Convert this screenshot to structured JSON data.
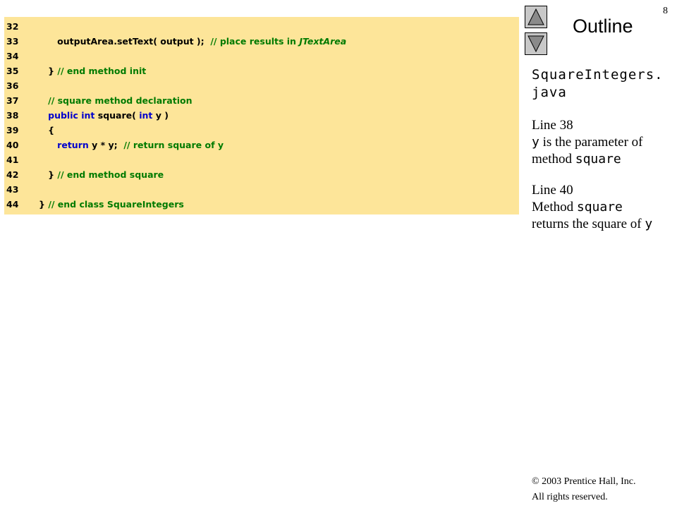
{
  "slide": {
    "number": "8",
    "outline_label": "Outline"
  },
  "code": {
    "lines": [
      {
        "num": "32",
        "segments": []
      },
      {
        "num": "33",
        "segments": [
          {
            "text": "         outputArea.setText( output );  ",
            "style": "plain"
          },
          {
            "text": "// place results in ",
            "style": "comment"
          },
          {
            "text": "JTextArea",
            "style": "comment-italic"
          }
        ]
      },
      {
        "num": "34",
        "segments": []
      },
      {
        "num": "35",
        "segments": [
          {
            "text": "      } ",
            "style": "plain"
          },
          {
            "text": "// end method init",
            "style": "comment"
          }
        ]
      },
      {
        "num": "36",
        "segments": []
      },
      {
        "num": "37",
        "segments": [
          {
            "text": "      ",
            "style": "plain"
          },
          {
            "text": "// square method declaration",
            "style": "comment"
          }
        ]
      },
      {
        "num": "38",
        "segments": [
          {
            "text": "      ",
            "style": "plain"
          },
          {
            "text": "public int",
            "style": "keyword"
          },
          {
            "text": " square( ",
            "style": "plain"
          },
          {
            "text": "int",
            "style": "keyword"
          },
          {
            "text": " y )",
            "style": "plain"
          }
        ]
      },
      {
        "num": "39",
        "segments": [
          {
            "text": "      {",
            "style": "plain"
          }
        ]
      },
      {
        "num": "40",
        "segments": [
          {
            "text": "         ",
            "style": "plain"
          },
          {
            "text": "return",
            "style": "keyword"
          },
          {
            "text": " y * y;  ",
            "style": "plain"
          },
          {
            "text": "// return square of y",
            "style": "comment"
          }
        ]
      },
      {
        "num": "41",
        "segments": []
      },
      {
        "num": "42",
        "segments": [
          {
            "text": "      } ",
            "style": "plain"
          },
          {
            "text": "// end method square",
            "style": "comment"
          }
        ]
      },
      {
        "num": "43",
        "segments": []
      },
      {
        "num": "44",
        "segments": [
          {
            "text": "   } ",
            "style": "plain"
          },
          {
            "text": "// end class SquareIntegers",
            "style": "comment"
          }
        ]
      }
    ]
  },
  "sidebar": {
    "filename_line1": "SquareIntegers.",
    "filename_line2": "java",
    "note1_heading": "Line 38",
    "note1_code1": "y",
    "note1_text1": " is the parameter of",
    "note1_text2": "method ",
    "note1_code2": "square",
    "note2_heading": "Line 40",
    "note2_text1": "Method ",
    "note2_code1": "square",
    "note2_text2": "returns the square of ",
    "note2_code2": "y"
  },
  "footer": {
    "copyright_symbol": "©",
    "copyright_line1": " 2003 Prentice Hall, Inc.",
    "copyright_line2": "All rights reserved."
  },
  "nav": {
    "up_icon": "triangle-up-icon",
    "down_icon": "triangle-down-icon",
    "button_color": "#c8c8c8"
  },
  "colors": {
    "code_background": "#fde599",
    "keyword": "#0000cc",
    "comment": "#007a00"
  }
}
